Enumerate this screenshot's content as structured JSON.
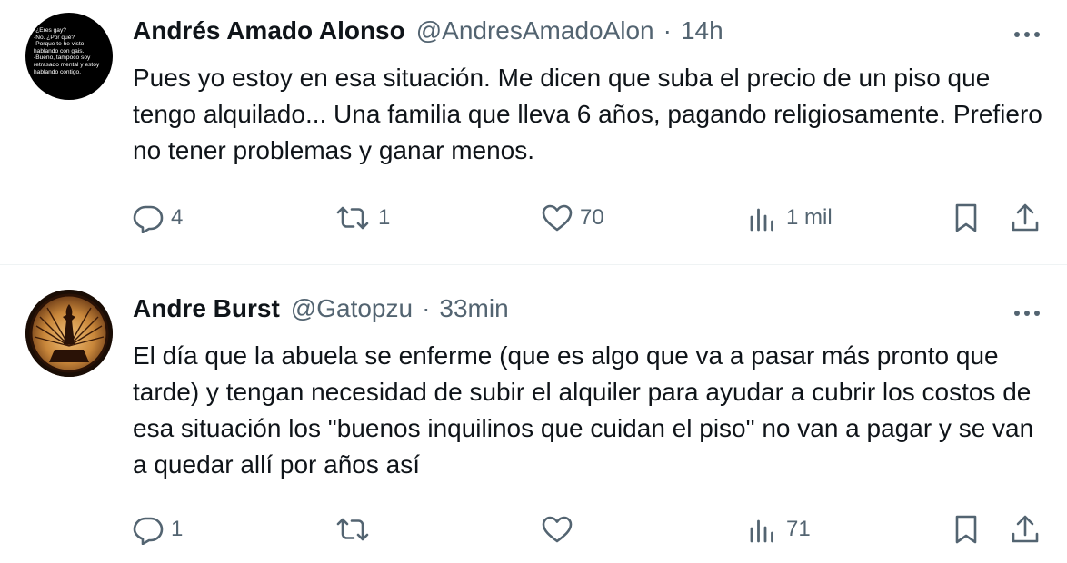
{
  "tweets": [
    {
      "name": "Andrés Amado Alonso",
      "handle": "@AndresAmadoAlon",
      "separator": "·",
      "time": "14h",
      "avatar_text": "-¿Eres gay?\n-No. ¿Por qué?\n-Porque te he visto\nhablando con gais.\n-Bueno, tampoco soy\nretrasado mental y estoy\nhablando contigo.",
      "text": "Pues yo estoy en esa situación. Me dicen que suba el precio de un piso que tengo alquilado... Una familia que lleva 6 años, pagando religiosamente. Prefiero no tener problemas y ganar menos.",
      "replies": "4",
      "retweets": "1",
      "likes": "70",
      "views": "1 mil"
    },
    {
      "name": "Andre Burst",
      "handle": "@Gatopzu",
      "separator": "·",
      "time": "33min",
      "text": "El día que la abuela se enferme (que es algo que va a pasar más pronto que tarde) y tengan necesidad de subir el alquiler para ayudar a cubrir los costos de esa situación los \"buenos inquilinos que cuidan el piso\" no van a pagar y se van a quedar allí por años así",
      "replies": "1",
      "retweets": "",
      "likes": "",
      "views": "71"
    }
  ],
  "colors": {
    "text": "#0f1419",
    "secondary": "#536471",
    "divider": "#eff3f4",
    "avatar2_gold": "#c8863a"
  },
  "icons": [
    "more-icon",
    "reply-icon",
    "retweet-icon",
    "like-icon",
    "views-icon",
    "bookmark-icon",
    "share-icon"
  ]
}
